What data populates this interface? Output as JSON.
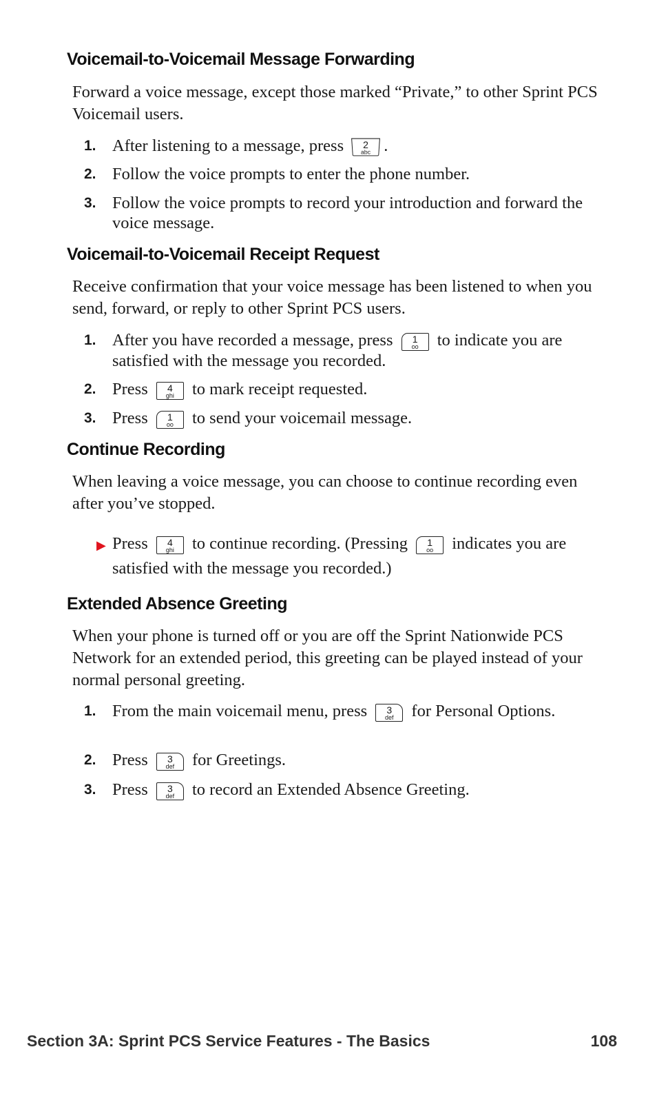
{
  "sections": [
    {
      "heading": "Voicemail-to-Voicemail Message Forwarding",
      "intro": "Forward a voice message, except those marked “Private,” to other Sprint PCS Voicemail users.",
      "steps": [
        {
          "num": "1.",
          "before": "After listening to a message, press",
          "key": {
            "digit": "2",
            "letters": "abc"
          },
          "after": "."
        },
        {
          "num": "2.",
          "text": "Follow the voice prompts to enter the phone number."
        },
        {
          "num": "3.",
          "text": "Follow the voice prompts to record your introduction and forward the voice message."
        }
      ]
    },
    {
      "heading": "Voicemail-to-Voicemail Receipt Request",
      "intro": "Receive confirmation that your voice message has been listened to when you send, forward, or reply to other Sprint PCS users.",
      "steps": [
        {
          "num": "1.",
          "before": "After you have recorded a message, press",
          "key": {
            "digit": "1",
            "letters": "oo"
          },
          "after": "to indicate you are satisfied with the message you recorded."
        },
        {
          "num": "2.",
          "before": "Press",
          "key": {
            "digit": "4",
            "letters": "ghi"
          },
          "after": "to mark receipt requested."
        },
        {
          "num": "3.",
          "before": "Press",
          "key": {
            "digit": "1",
            "letters": "oo"
          },
          "after": "to send your voicemail message."
        }
      ]
    },
    {
      "heading": "Continue Recording",
      "intro": "When leaving a voice message, you can choose to continue recording even after you’ve stopped.",
      "bullet": {
        "before": "Press",
        "key1": {
          "digit": "4",
          "letters": "ghi"
        },
        "middle": "to continue recording. (Pressing",
        "key2": {
          "digit": "1",
          "letters": "oo"
        },
        "after": "indicates you are satisfied with the message you recorded.)"
      }
    },
    {
      "heading": "Extended Absence Greeting",
      "intro": "When your phone is turned off or you are off the Sprint Nationwide PCS Network for an extended period, this greeting can be played instead of your normal personal greeting.",
      "steps": [
        {
          "num": "1.",
          "before": "From the main voicemail menu, press",
          "key": {
            "digit": "3",
            "letters": "def"
          },
          "after": "for Personal Options."
        },
        {
          "num": "2.",
          "before": "Press",
          "key": {
            "digit": "3",
            "letters": "def"
          },
          "after": "for Greetings."
        },
        {
          "num": "3.",
          "before": "Press",
          "key": {
            "digit": "3",
            "letters": "def"
          },
          "after": "to record an Extended Absence Greeting."
        }
      ]
    }
  ],
  "footer": {
    "section_title": "Section 3A: Sprint PCS Service Features - The Basics",
    "page_number": "108"
  },
  "colors": {
    "bullet_arrow": "#e0141e"
  }
}
